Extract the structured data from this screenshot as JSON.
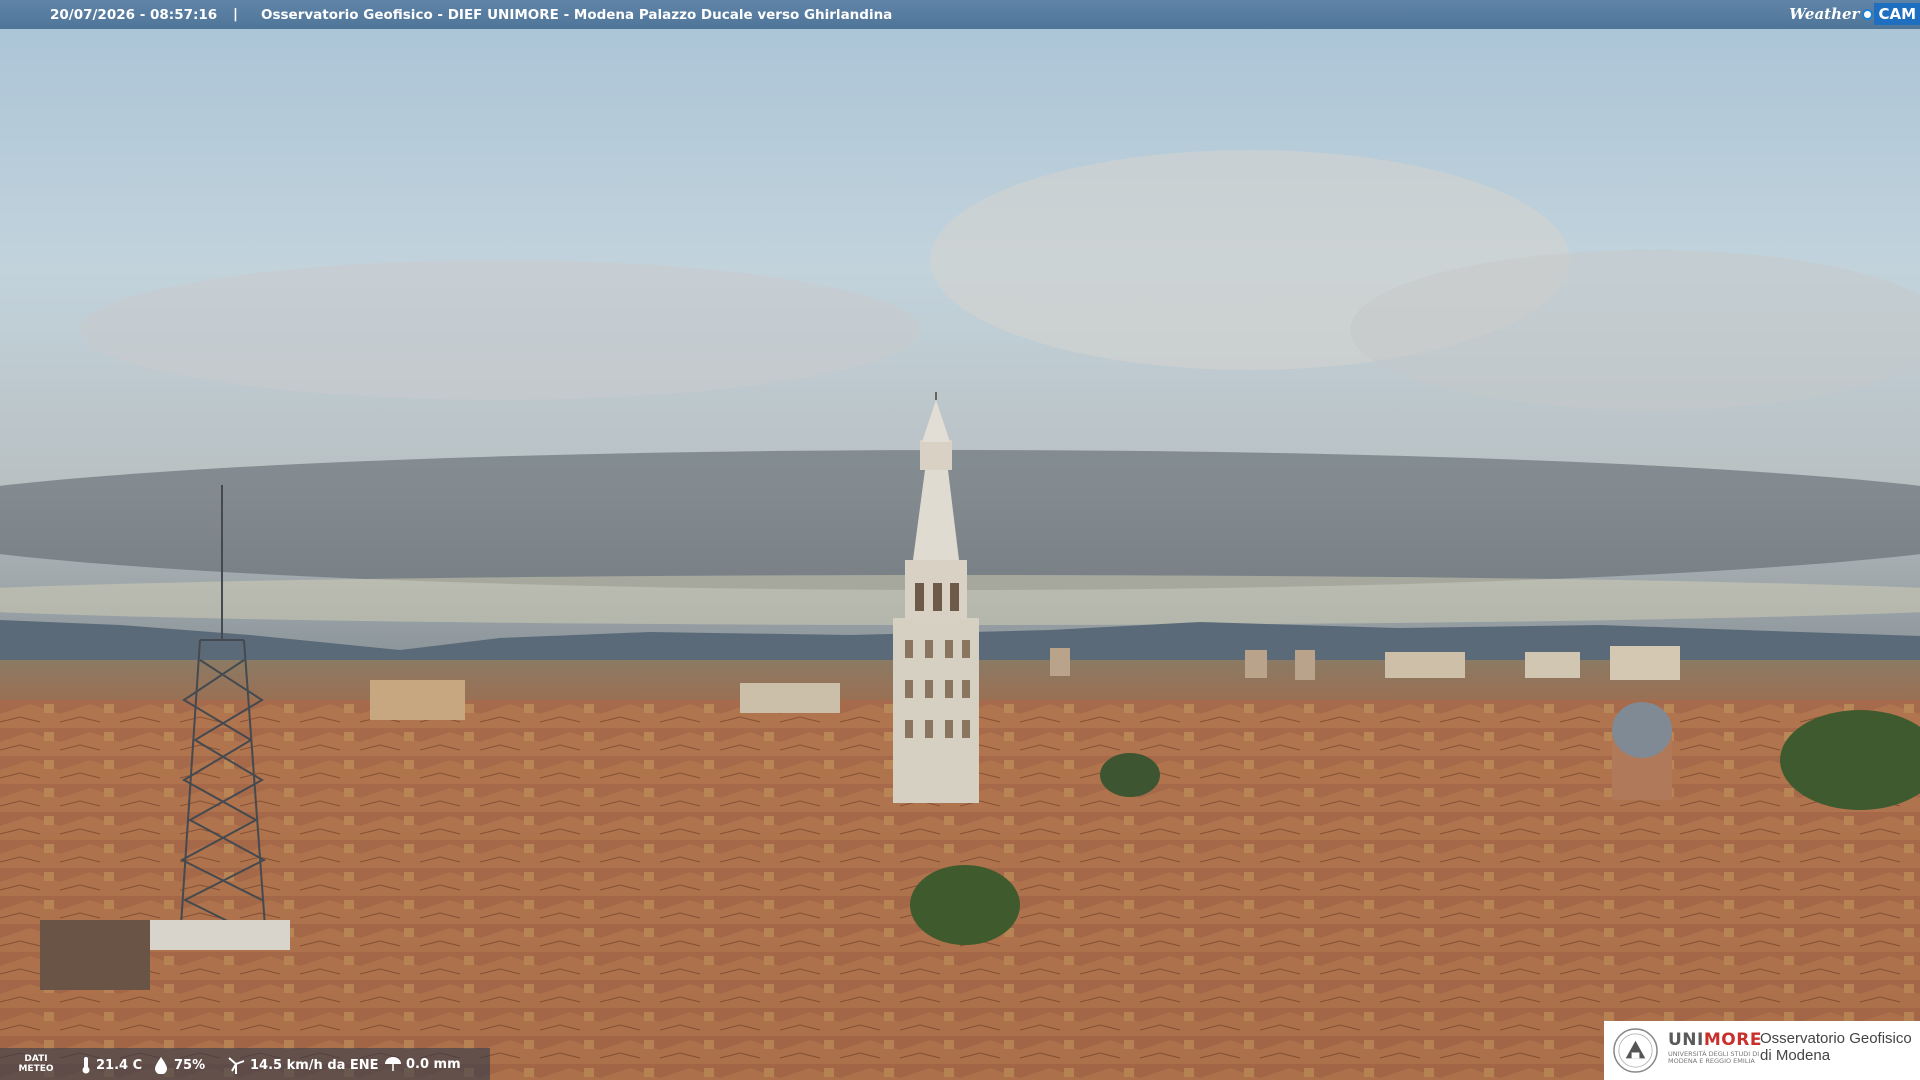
{
  "header": {
    "timestamp": "20/07/2026 - 08:57:16",
    "separator": "|",
    "title": "Osservatorio Geofisico - DIEF UNIMORE - Modena Palazzo Ducale verso Ghirlandina",
    "brand_weather": "Weather",
    "brand_cam": "CAM"
  },
  "meteo": {
    "label": "DATI METEO",
    "temperature": "21.4 C",
    "humidity": "75%",
    "wind": "14.5 km/h da ENE",
    "rain": "0.0 mm"
  },
  "logo": {
    "uni": "UNI",
    "more": "MORE",
    "university": "UNIVERSITÀ DEGLI STUDI DI MODENA E REGGIO EMILIA",
    "observatory_line1": "Osservatorio Geofisico",
    "observatory_line2": "di Modena"
  },
  "colors": {
    "header_bar": "#5577a0",
    "brand_blue": "#1f6fc0",
    "unimore_red": "#c9302c"
  }
}
